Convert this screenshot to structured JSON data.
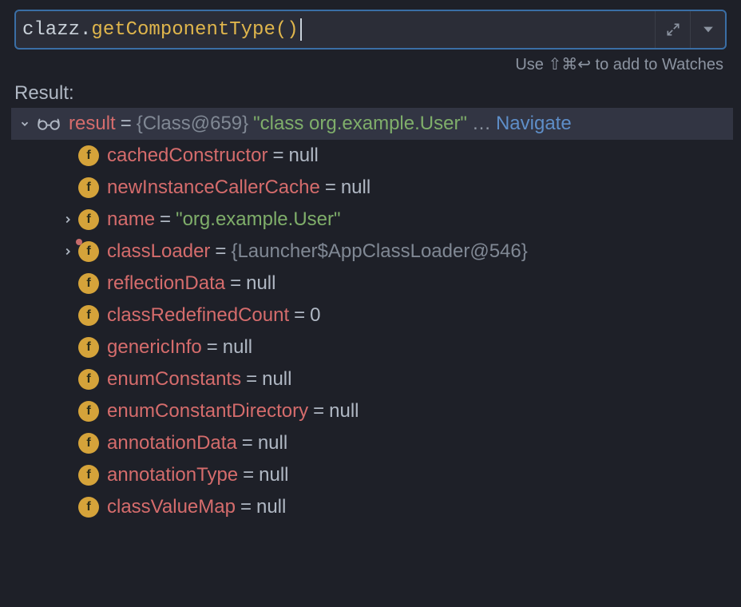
{
  "expression": {
    "object": "clazz",
    "dot": ".",
    "method": "getComponentType",
    "paren_open": "(",
    "paren_close": ")"
  },
  "hint": "Use ⇧⌘↩ to add to Watches",
  "result_label": "Result:",
  "root": {
    "name": "result",
    "eq": "=",
    "type": "{Class@659}",
    "value": "\"class org.example.User\"",
    "ellipsis": "…",
    "navigate": "Navigate"
  },
  "fields": [
    {
      "name": "cachedConstructor",
      "eq": "=",
      "value": "null",
      "kind": "null",
      "expandable": false
    },
    {
      "name": "newInstanceCallerCache",
      "eq": "=",
      "value": "null",
      "kind": "null",
      "expandable": false
    },
    {
      "name": "name",
      "eq": "=",
      "value": "\"org.example.User\"",
      "kind": "string",
      "expandable": true
    },
    {
      "name": "classLoader",
      "eq": "=",
      "value": "{Launcher$AppClassLoader@546}",
      "kind": "type",
      "expandable": true,
      "mark": true
    },
    {
      "name": "reflectionData",
      "eq": "=",
      "value": "null",
      "kind": "null",
      "expandable": false
    },
    {
      "name": "classRedefinedCount",
      "eq": "=",
      "value": "0",
      "kind": "num",
      "expandable": false
    },
    {
      "name": "genericInfo",
      "eq": "=",
      "value": "null",
      "kind": "null",
      "expandable": false
    },
    {
      "name": "enumConstants",
      "eq": "=",
      "value": "null",
      "kind": "null",
      "expandable": false
    },
    {
      "name": "enumConstantDirectory",
      "eq": "=",
      "value": "null",
      "kind": "null",
      "expandable": false
    },
    {
      "name": "annotationData",
      "eq": "=",
      "value": "null",
      "kind": "null",
      "expandable": false
    },
    {
      "name": "annotationType",
      "eq": "=",
      "value": "null",
      "kind": "null",
      "expandable": false
    },
    {
      "name": "classValueMap",
      "eq": "=",
      "value": "null",
      "kind": "null",
      "expandable": false
    }
  ],
  "field_icon_letter": "f"
}
